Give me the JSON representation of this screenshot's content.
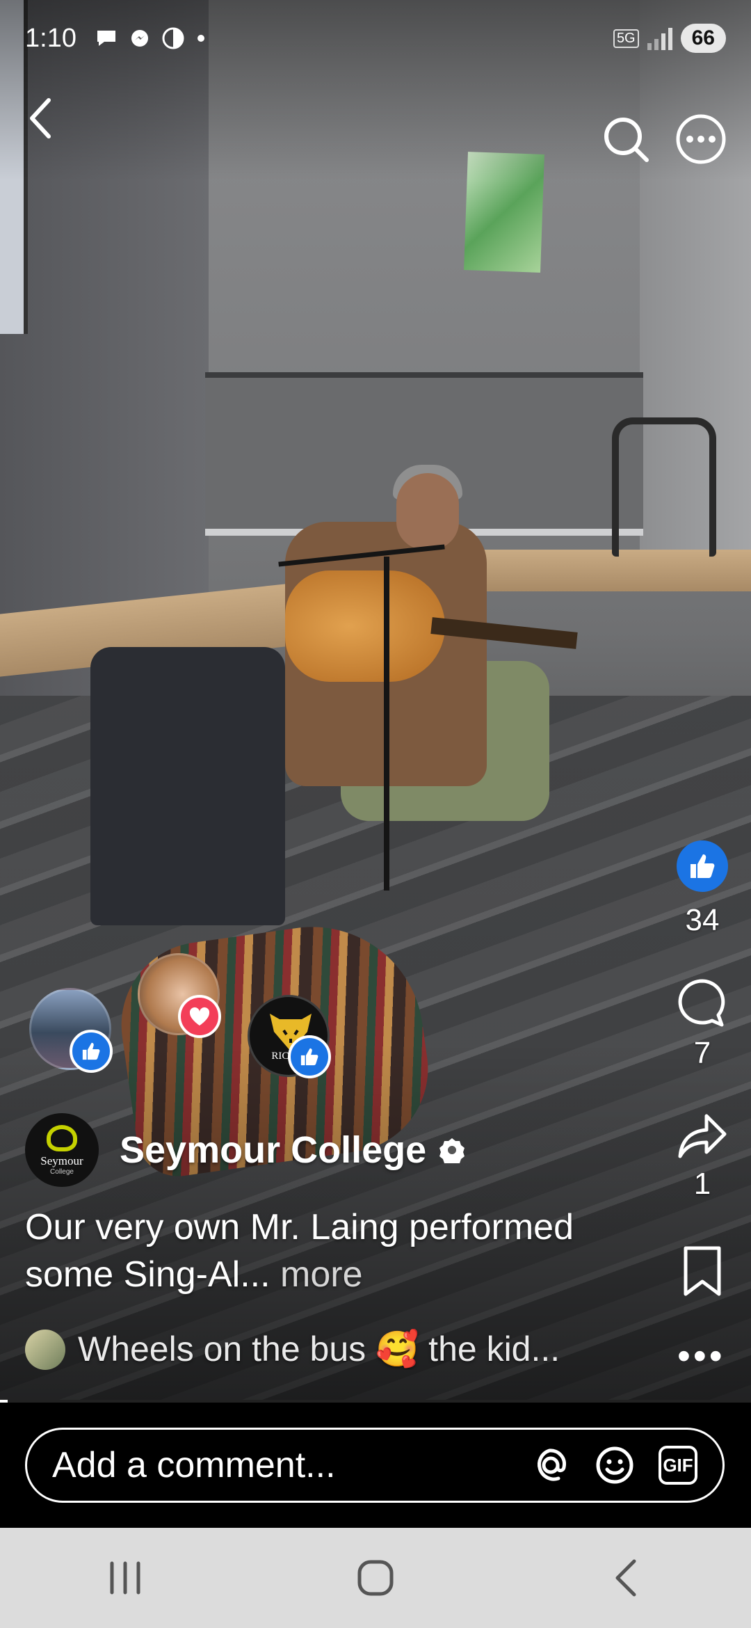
{
  "status_bar": {
    "time": "1:10",
    "network": "5G",
    "battery": "66"
  },
  "video": {
    "progress": 0.01
  },
  "actions": {
    "likes": "34",
    "comments": "7",
    "shares": "1"
  },
  "author": {
    "name": "Seymour College",
    "logo_text": "Seymour",
    "logo_subtext": "College"
  },
  "caption": {
    "text": "Our very own Mr. Laing performed some Sing-Al... ",
    "more": "more"
  },
  "comment_preview": {
    "text": "Wheels on the bus 🥰 the kid..."
  },
  "comment_bar": {
    "placeholder": "Add a comment...",
    "gif_label": "GIF"
  },
  "reactors": [
    {
      "reaction": "like",
      "label": ""
    },
    {
      "reaction": "love",
      "label": ""
    },
    {
      "reaction": "like",
      "label": "RICHM"
    }
  ],
  "colors": {
    "like_blue": "#1b74e4",
    "love_red": "#f33e58"
  }
}
